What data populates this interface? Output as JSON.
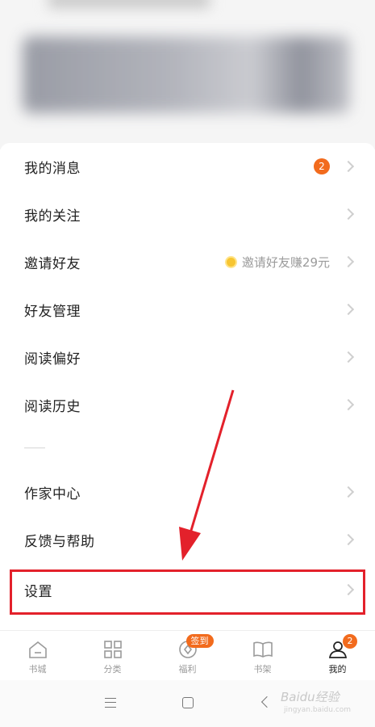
{
  "menu": {
    "items": [
      {
        "label": "我的消息",
        "badge": "2"
      },
      {
        "label": "我的关注"
      },
      {
        "label": "邀请好友",
        "note": "邀请好友赚29元"
      },
      {
        "label": "好友管理"
      },
      {
        "label": "阅读偏好"
      },
      {
        "label": "阅读历史"
      },
      {
        "label": "作家中心"
      },
      {
        "label": "反馈与帮助"
      },
      {
        "label": "设置"
      }
    ]
  },
  "tabbar": {
    "tabs": [
      {
        "label": "书城"
      },
      {
        "label": "分类"
      },
      {
        "label": "福利",
        "badge": "签到"
      },
      {
        "label": "书架"
      },
      {
        "label": "我的",
        "badge": "2",
        "active": true
      }
    ]
  },
  "watermark": {
    "text": "Baidu经验",
    "sub": "jingyan.baidu.com"
  },
  "colors": {
    "accent": "#f26b1d",
    "highlight": "#e3212b"
  }
}
